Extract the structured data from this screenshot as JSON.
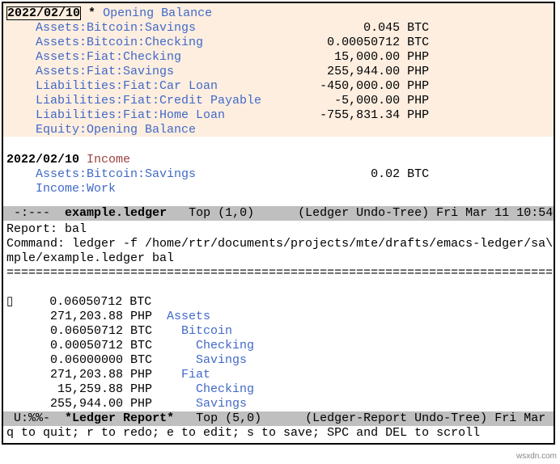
{
  "opening": {
    "date": "2022/02/10",
    "star": "*",
    "payee": "Opening Balance",
    "lines": [
      {
        "acct": "Assets:Bitcoin:Savings",
        "amt": "0.045 BTC"
      },
      {
        "acct": "Assets:Bitcoin:Checking",
        "amt": "0.00050712 BTC"
      },
      {
        "acct": "Assets:Fiat:Checking",
        "amt": "15,000.00 PHP"
      },
      {
        "acct": "Assets:Fiat:Savings",
        "amt": "255,944.00 PHP"
      },
      {
        "acct": "Liabilities:Fiat:Car Loan",
        "amt": "-450,000.00 PHP"
      },
      {
        "acct": "Liabilities:Fiat:Credit Payable",
        "amt": "-5,000.00 PHP"
      },
      {
        "acct": "Liabilities:Fiat:Home Loan",
        "amt": "-755,831.34 PHP"
      },
      {
        "acct": "Equity:Opening Balance",
        "amt": ""
      }
    ]
  },
  "income_tx": {
    "date": "2022/02/10",
    "payee": "Income",
    "lines": [
      {
        "acct": "Assets:Bitcoin:Savings",
        "amt": "0.02 BTC"
      },
      {
        "acct": "Income:Work",
        "amt": ""
      }
    ]
  },
  "modeline1": {
    "left": "-:---",
    "buffer": "example.ledger",
    "pos": "Top (1,0)",
    "modes": "(Ledger Undo-Tree)",
    "time": "Fri Mar 11 10:54"
  },
  "report": {
    "title": "Report: bal",
    "cmd": "Command: ledger -f /home/rtr/documents/projects/mte/drafts/emacs-ledger/sa\\",
    "cmd2": "mple/example.ledger bal",
    "hr": "===========================================================================",
    "lines": [
      {
        "amt": "0.06050712 BTC",
        "acct": "",
        "indent": 0
      },
      {
        "amt": "271,203.88 PHP",
        "acct": "Assets",
        "indent": 0
      },
      {
        "amt": "0.06050712 BTC",
        "acct": "Bitcoin",
        "indent": 1
      },
      {
        "amt": "0.00050712 BTC",
        "acct": "Checking",
        "indent": 2
      },
      {
        "amt": "0.06000000 BTC",
        "acct": "Savings",
        "indent": 2
      },
      {
        "amt": "271,203.88 PHP",
        "acct": "Fiat",
        "indent": 1
      },
      {
        "amt": "15,259.88 PHP",
        "acct": "Checking",
        "indent": 2
      },
      {
        "amt": "255,944.00 PHP",
        "acct": "Savings",
        "indent": 2
      }
    ],
    "cursor": "▯"
  },
  "modeline2": {
    "left": "U:%%-",
    "buffer": "*Ledger Report*",
    "pos": "Top (5,0)",
    "modes": "(Ledger-Report Undo-Tree)",
    "time": "Fri Mar"
  },
  "echo": "q to quit; r to redo; e to edit; s to save; SPC and DEL to scroll",
  "watermark": "wsxdn.com"
}
